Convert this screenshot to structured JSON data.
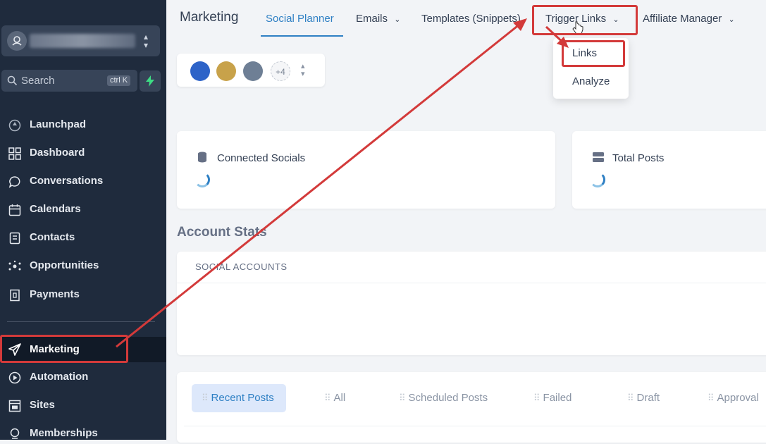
{
  "app": {
    "section_title": "Marketing"
  },
  "sidebar": {
    "search_placeholder": "Search",
    "search_shortcut": "ctrl K",
    "items": [
      {
        "label": "Launchpad",
        "icon": "rocket-icon"
      },
      {
        "label": "Dashboard",
        "icon": "grid-icon"
      },
      {
        "label": "Conversations",
        "icon": "chat-icon"
      },
      {
        "label": "Calendars",
        "icon": "calendar-icon"
      },
      {
        "label": "Contacts",
        "icon": "contact-book-icon"
      },
      {
        "label": "Opportunities",
        "icon": "network-icon"
      },
      {
        "label": "Payments",
        "icon": "receipt-icon"
      },
      {
        "label": "Marketing",
        "icon": "paper-plane-icon"
      },
      {
        "label": "Automation",
        "icon": "play-circle-icon"
      },
      {
        "label": "Sites",
        "icon": "window-icon"
      },
      {
        "label": "Memberships",
        "icon": "member-icon"
      }
    ]
  },
  "topnav": {
    "tabs": [
      {
        "label": "Social Planner",
        "active": true
      },
      {
        "label": "Emails",
        "has_menu": true
      },
      {
        "label": "Templates (Snippets)"
      },
      {
        "label": "Trigger Links",
        "has_menu": true
      },
      {
        "label": "Affiliate Manager",
        "has_menu": true
      }
    ]
  },
  "dropdown": {
    "items": [
      "Links",
      "Analyze"
    ]
  },
  "avatars": {
    "more_label": "+4"
  },
  "stats": {
    "connected_socials": "Connected Socials",
    "total_posts": "Total Posts"
  },
  "account_stats": {
    "title": "Account Stats",
    "social_accounts_label": "SOCIAL ACCOUNTS"
  },
  "post_tabs": [
    "Recent Posts",
    "All",
    "Scheduled Posts",
    "Failed",
    "Draft",
    "Approval"
  ],
  "colors": {
    "accent": "#2f80c4",
    "sidebar_bg": "#1f2b3d",
    "annotation": "#d33a3a"
  }
}
